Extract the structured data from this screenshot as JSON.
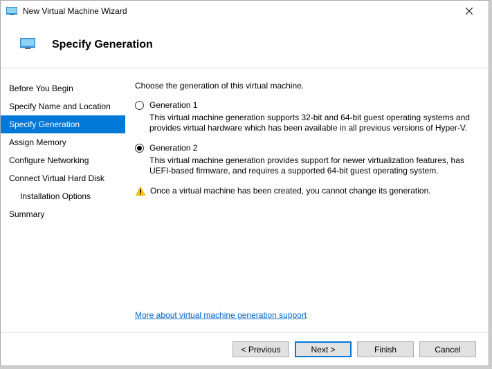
{
  "window": {
    "title": "New Virtual Machine Wizard"
  },
  "header": {
    "title": "Specify Generation"
  },
  "sidebar": {
    "items": [
      {
        "label": "Before You Begin",
        "selected": false,
        "indent": false
      },
      {
        "label": "Specify Name and Location",
        "selected": false,
        "indent": false
      },
      {
        "label": "Specify Generation",
        "selected": true,
        "indent": false
      },
      {
        "label": "Assign Memory",
        "selected": false,
        "indent": false
      },
      {
        "label": "Configure Networking",
        "selected": false,
        "indent": false
      },
      {
        "label": "Connect Virtual Hard Disk",
        "selected": false,
        "indent": false
      },
      {
        "label": "Installation Options",
        "selected": false,
        "indent": true
      },
      {
        "label": "Summary",
        "selected": false,
        "indent": false
      }
    ]
  },
  "content": {
    "intro": "Choose the generation of this virtual machine.",
    "options": [
      {
        "label": "Generation 1",
        "checked": false,
        "description": "This virtual machine generation supports 32-bit and 64-bit guest operating systems and provides virtual hardware which has been available in all previous versions of Hyper-V."
      },
      {
        "label": "Generation 2",
        "checked": true,
        "description": "This virtual machine generation provides support for newer virtualization features, has UEFI-based firmware, and requires a supported 64-bit guest operating system."
      }
    ],
    "warning": "Once a virtual machine has been created, you cannot change its generation.",
    "link": "More about virtual machine generation support"
  },
  "footer": {
    "previous": "< Previous",
    "next": "Next >",
    "finish": "Finish",
    "cancel": "Cancel"
  }
}
